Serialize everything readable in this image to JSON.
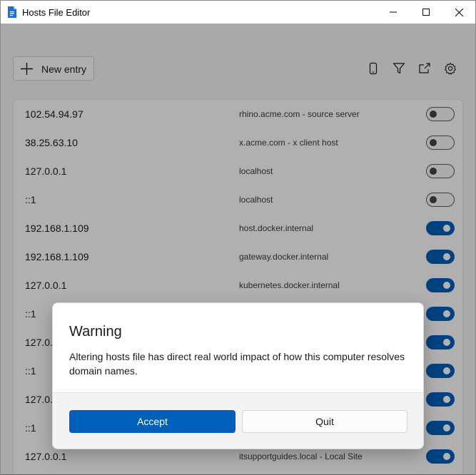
{
  "window": {
    "title": "Hosts File Editor"
  },
  "toolbar": {
    "new_entry_label": "New entry",
    "icons": [
      "phone-icon",
      "filter-icon",
      "export-icon",
      "gear-icon"
    ]
  },
  "entries": [
    {
      "ip": "102.54.94.97",
      "host": "rhino.acme.com - source server",
      "enabled": false
    },
    {
      "ip": "38.25.63.10",
      "host": "x.acme.com - x client host",
      "enabled": false
    },
    {
      "ip": "127.0.0.1",
      "host": "localhost",
      "enabled": false
    },
    {
      "ip": "::1",
      "host": "localhost",
      "enabled": false
    },
    {
      "ip": "192.168.1.109",
      "host": "host.docker.internal",
      "enabled": true
    },
    {
      "ip": "192.168.1.109",
      "host": "gateway.docker.internal",
      "enabled": true
    },
    {
      "ip": "127.0.0.1",
      "host": "kubernetes.docker.internal",
      "enabled": true
    },
    {
      "ip": "::1",
      "host": "",
      "enabled": true
    },
    {
      "ip": "127.0.0",
      "host": "",
      "enabled": true
    },
    {
      "ip": "::1",
      "host": "",
      "enabled": true
    },
    {
      "ip": "127.0.0",
      "host": "",
      "enabled": true
    },
    {
      "ip": "::1",
      "host": "",
      "enabled": true
    },
    {
      "ip": "127.0.0.1",
      "host": "itsupportguides.local - Local Site",
      "enabled": true
    }
  ],
  "dialog": {
    "title": "Warning",
    "message": "Altering hosts file has direct real world impact of how this computer resolves domain names.",
    "accept_label": "Accept",
    "quit_label": "Quit"
  },
  "colors": {
    "accent": "#005fb8",
    "background": "#f3f3f3"
  }
}
